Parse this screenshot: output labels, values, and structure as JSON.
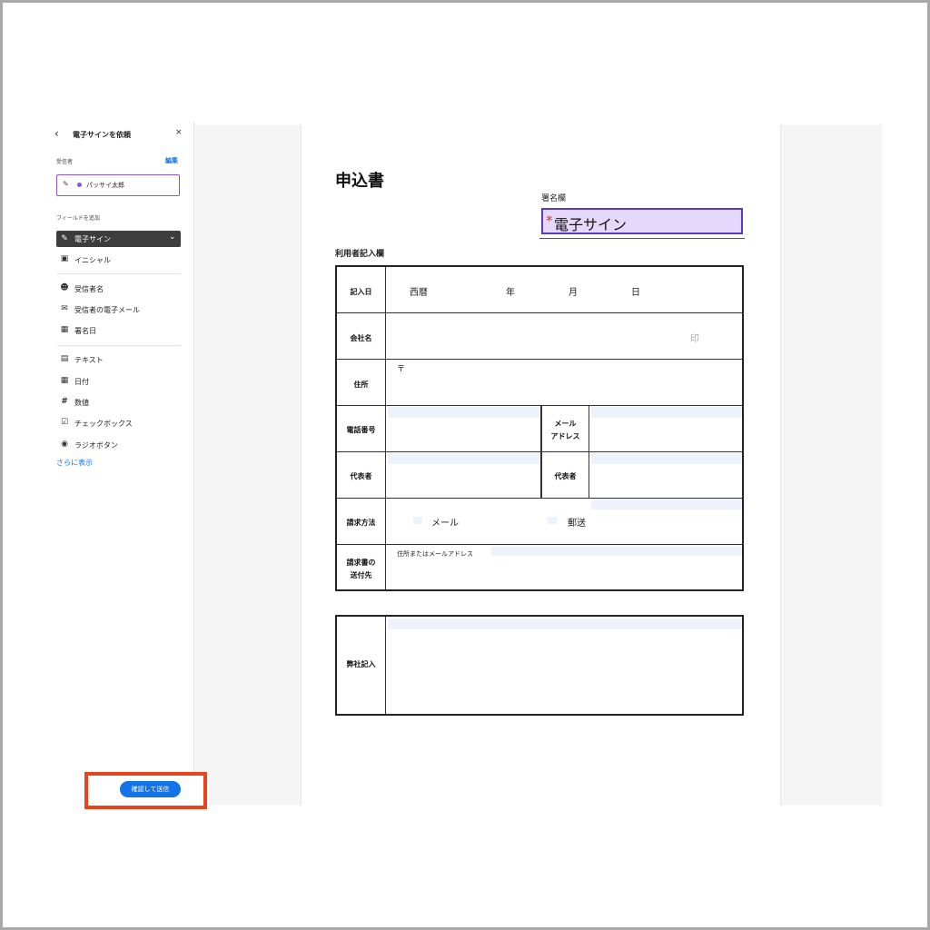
{
  "panel": {
    "title": "電子サインを依頼",
    "recipients_label": "受信者",
    "edit_link": "編集",
    "recipient_name": "パッサイ太郎",
    "add_field_label": "フィールドを追加",
    "fields": {
      "signature": "電子サイン",
      "initial": "イニシャル",
      "recipient_name": "受信者名",
      "recipient_email": "受信者の電子メール",
      "sign_date": "署名日",
      "text": "テキスト",
      "date": "日付",
      "number": "数値",
      "checkbox": "チェックボックス",
      "radio": "ラジオボタン"
    },
    "show_more": "さらに表示",
    "confirm_button": "確認して送信"
  },
  "document": {
    "title": "申込書",
    "signature_label": "署名欄",
    "signature_field": "電子サイン",
    "signature_required_mark": "*",
    "section_label": "利用者記入欄",
    "rows": {
      "entry_date": "記入日",
      "era": "西暦",
      "year": "年",
      "month": "月",
      "day": "日",
      "company": "会社名",
      "seal": "印",
      "address": "住所",
      "postal_mark": "〒",
      "phone": "電話番号",
      "mail_address_1": "メール",
      "mail_address_2": "アドレス",
      "representative": "代表者",
      "representative2": "代表者",
      "billing_method": "請求方法",
      "billing_mail": "メール",
      "billing_post": "郵送",
      "invoice_dest_1": "請求書の",
      "invoice_dest_2": "送付先",
      "invoice_dest_hint": "住所またはメールアドレス"
    },
    "office_use": "弊社記入"
  }
}
